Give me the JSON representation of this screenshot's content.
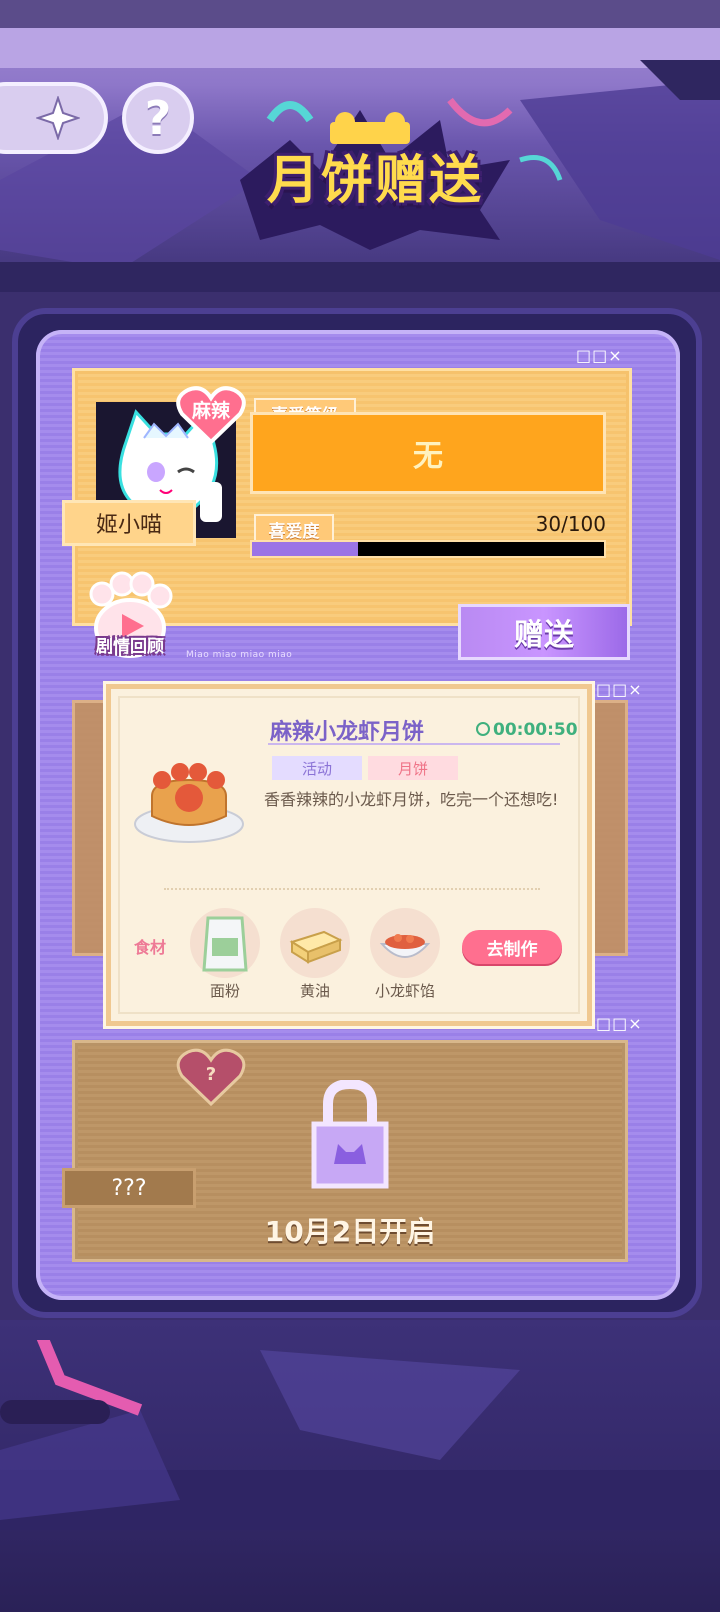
{
  "header": {
    "title": "月饼赠送",
    "help_label": "?"
  },
  "window_controls": "□□×",
  "character": {
    "name": "姬小喵",
    "flavor_badge": "麻辣",
    "affection_level_label": "喜爱等级",
    "affection_level_value": "无",
    "affection_label": "喜爱度",
    "affection_value": "30/100",
    "affection_progress": 0.3,
    "review_label": "剧情回顾",
    "tiny_caption": "Miao miao miao miao",
    "gift_button": "赠送"
  },
  "popup": {
    "dish_name": "麻辣小龙虾月饼",
    "timer": "00:00:50",
    "tags": [
      "活动",
      "月饼"
    ],
    "description": "香香辣辣的小龙虾月饼，吃完一个还想吃!",
    "ingredients_label": "食材",
    "ingredients": [
      "面粉",
      "黄油",
      "小龙虾馅"
    ],
    "make_button": "去制作"
  },
  "locked_slot": {
    "name": "???",
    "heart_mark": "?",
    "unlock_text": "10月2日开启"
  },
  "colors": {
    "accent_purple": "#9b74e6",
    "level_orange": "#ffa51d",
    "make_pink": "#ff6f8f",
    "timer_green": "#3fb07e"
  }
}
